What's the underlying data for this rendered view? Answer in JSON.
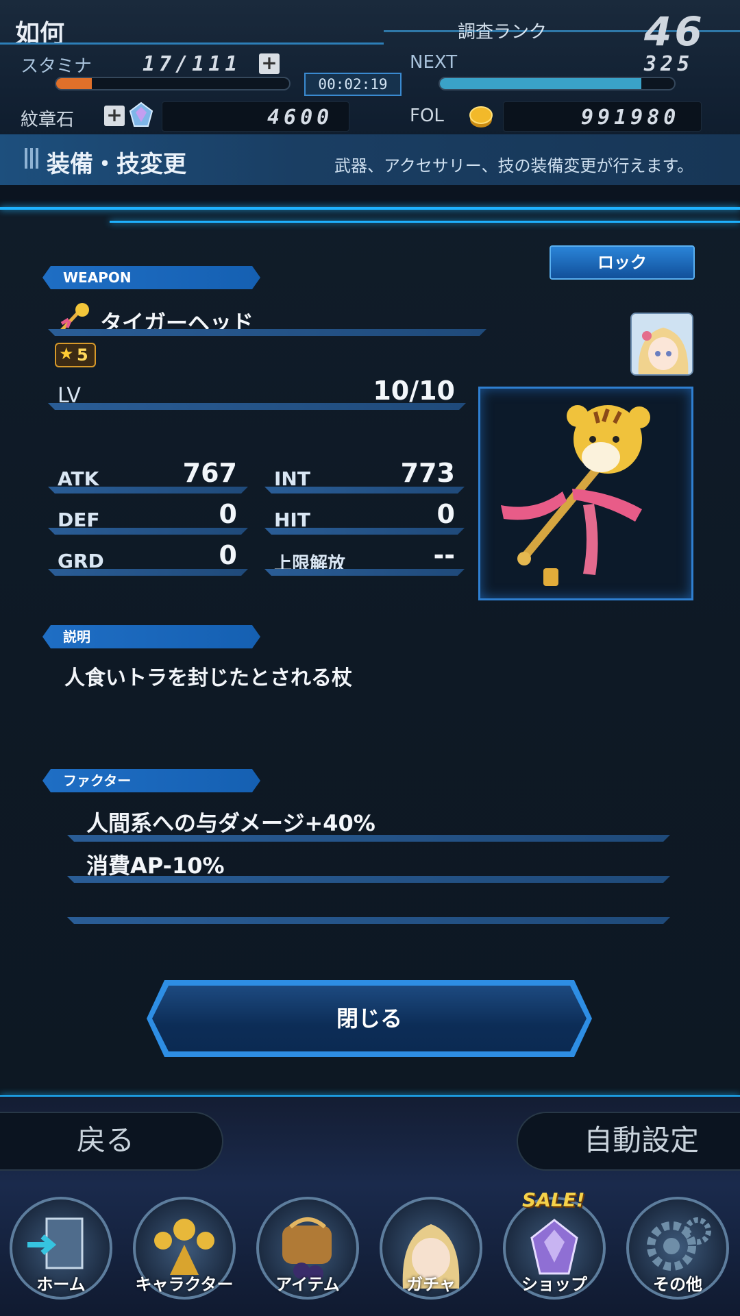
{
  "header": {
    "player_name": "如何",
    "rank_label": "調査ランク",
    "rank_value": "46",
    "stamina_label": "スタミナ",
    "stamina_value": "17/111",
    "stamina_fraction": 0.153,
    "timer": "00:02:19",
    "next_label": "NEXT",
    "next_value": "325",
    "next_fraction": 0.86,
    "crest_label": "紋章石",
    "crest_value": "4600",
    "fol_label": "FOL",
    "fol_value": "991980",
    "plus_symbol": "+"
  },
  "section": {
    "title": "装備・技変更",
    "description": "武器、アクセサリー、技の装備変更が行えます。"
  },
  "weapon": {
    "tag": "WEAPON",
    "lock_label": "ロック",
    "name": "タイガーヘッド",
    "rarity": "5",
    "lv_label": "LV",
    "lv_value": "10/10",
    "stats": {
      "atk_label": "ATK",
      "atk_value": "767",
      "int_label": "INT",
      "int_value": "773",
      "def_label": "DEF",
      "def_value": "0",
      "hit_label": "HIT",
      "hit_value": "0",
      "grd_label": "GRD",
      "grd_value": "0",
      "limit_label": "上限解放",
      "limit_value": "--"
    }
  },
  "description": {
    "tag": "説明",
    "text": "人食いトラを封じたとされる杖"
  },
  "factor": {
    "tag": "ファクター",
    "items": [
      "人間系への与ダメージ+40%",
      "消費AP-10%",
      ""
    ]
  },
  "close_label": "閉じる",
  "bottom": {
    "back_label": "戻る",
    "auto_label": "自動設定",
    "sale_badge": "SALE!",
    "nav": [
      "ホーム",
      "キャラクター",
      "アイテム",
      "ガチャ",
      "ショップ",
      "その他"
    ]
  },
  "colors": {
    "accent": "#1fb2ff",
    "stamina_fill": "#e0702a",
    "next_fill": "#3aa2c8",
    "panel_bg": "#0e1925"
  }
}
